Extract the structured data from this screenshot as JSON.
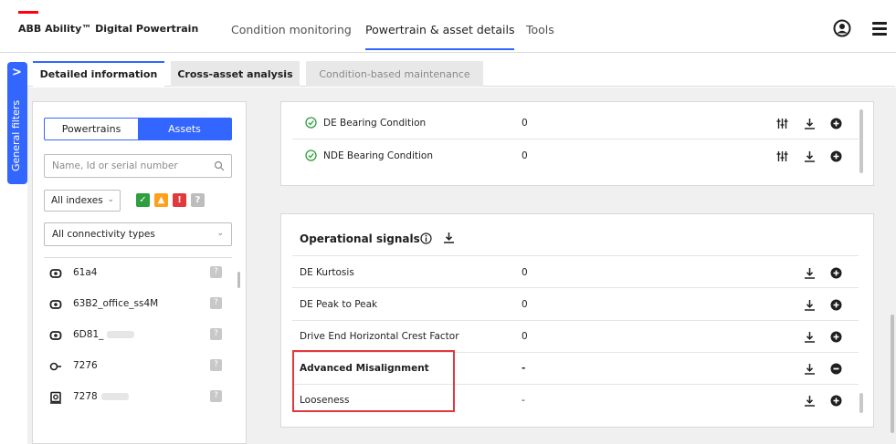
{
  "header": {
    "brand": "ABB Ability™ Digital Powertrain",
    "nav": [
      "Condition monitoring",
      "Powertrain & asset details",
      "Tools"
    ],
    "active_nav": "Powertrain & asset details"
  },
  "sidebar": {
    "label": "General filters"
  },
  "tabs": {
    "detailed": "Detailed information",
    "cross": "Cross-asset analysis",
    "cbm": "Condition-based maintenance"
  },
  "filters": {
    "toggle": [
      "Powertrains",
      "Assets"
    ],
    "toggle_selected": "Assets",
    "search_placeholder": "Name, Id or serial number",
    "index_select": "All indexes",
    "connectivity_select": "All connectivity types",
    "status_colors": {
      "good": "#2e9e3e",
      "warning": "#ff9f1a",
      "alarm": "#e0393e",
      "unknown": "#bdbdbd"
    }
  },
  "assets": [
    {
      "name": "61a4",
      "icon": "motor-icon"
    },
    {
      "name": "63B2_office_ss4M",
      "icon": "motor-icon"
    },
    {
      "name": "6D81_",
      "icon": "motor-icon"
    },
    {
      "name": "7276",
      "icon": "pump-icon"
    },
    {
      "name": "7278",
      "icon": "drive-icon"
    }
  ],
  "condition_rows": [
    {
      "label": "DE Bearing Condition",
      "value": "0"
    },
    {
      "label": "NDE Bearing Condition",
      "value": "0"
    }
  ],
  "operational": {
    "title": "Operational signals",
    "rows": [
      {
        "label": "DE Kurtosis",
        "value": "0"
      },
      {
        "label": "DE Peak to Peak",
        "value": "0"
      },
      {
        "label": "Drive End Horizontal Crest Factor",
        "value": "0"
      },
      {
        "label": "Advanced Misalignment",
        "value": "-"
      },
      {
        "label": "Looseness",
        "value": "-"
      }
    ]
  },
  "colors": {
    "accent": "#3366ff",
    "brand_red": "#ff000f",
    "highlight": "#e0393e"
  }
}
